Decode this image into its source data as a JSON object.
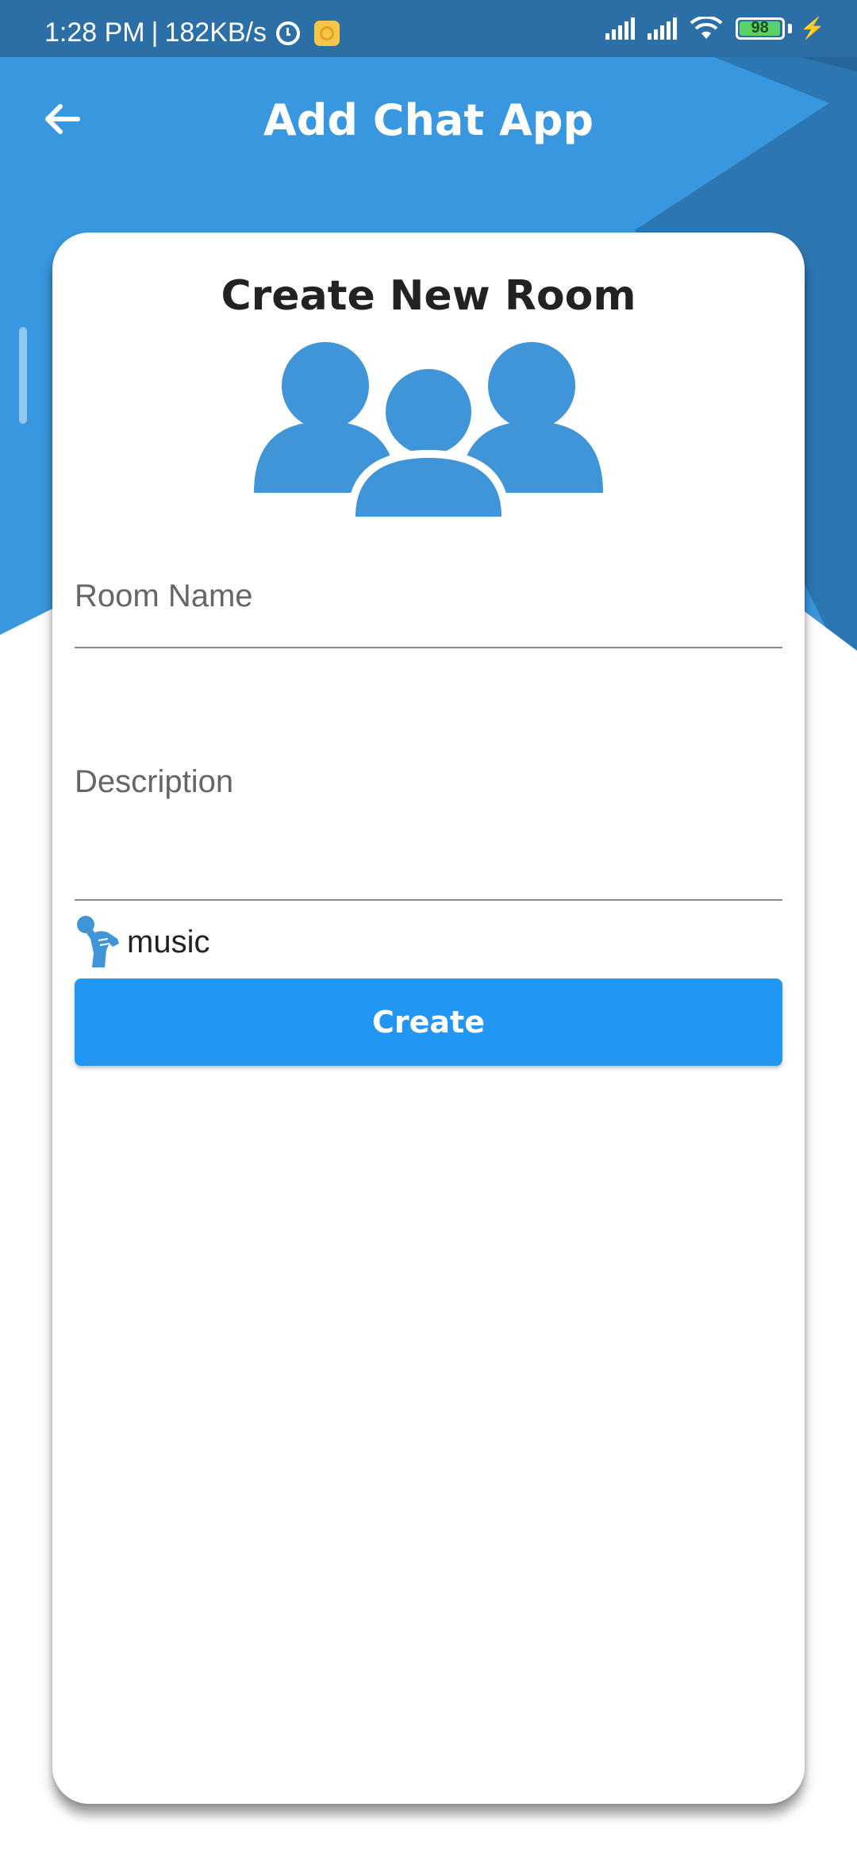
{
  "status_bar": {
    "time": "1:28 PM",
    "separator": "|",
    "speed": "182KB/s",
    "battery_level": "98",
    "battery_fraction": 0.98
  },
  "app_bar": {
    "title": "Add Chat App",
    "back_icon": "arrow-back-icon"
  },
  "card": {
    "title": "Create New Room",
    "group_icon": "group-users-icon",
    "room_name_placeholder": "Room Name",
    "room_name_value": "",
    "description_placeholder": "Description",
    "description_value": "",
    "category": {
      "icon": "microphone-hand-icon",
      "label": "music"
    },
    "create_label": "Create"
  },
  "colors": {
    "primary": "#3897de",
    "primary_dark": "#2c77b2",
    "button": "#2196f3",
    "icon_blue": "#3f95d8"
  }
}
